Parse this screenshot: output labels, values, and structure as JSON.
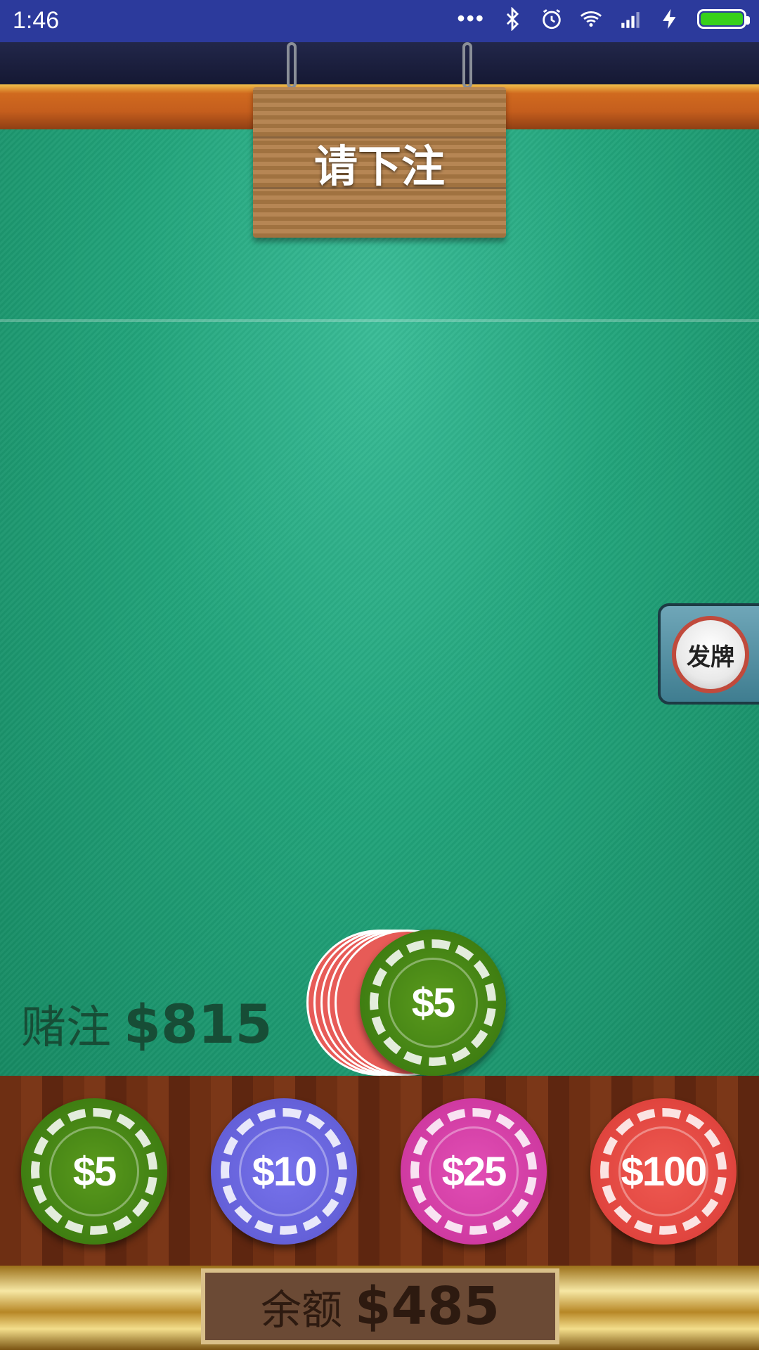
{
  "status_bar": {
    "time": "1:46",
    "icons": [
      "more-dots-icon",
      "bluetooth-icon",
      "alarm-icon",
      "wifi-icon",
      "signal-icon",
      "charging-icon",
      "battery-icon"
    ],
    "battery_level": 1.0
  },
  "sign": {
    "text": "请下注"
  },
  "deal_button": {
    "label": "发牌"
  },
  "bet": {
    "label": "赌注",
    "amount": "$815"
  },
  "stack": {
    "top_chip_label": "$5"
  },
  "chips": [
    {
      "label": "$5",
      "color": "#3f7e12"
    },
    {
      "label": "$10",
      "color": "#6460d8"
    },
    {
      "label": "$25",
      "color": "#cf3aa1"
    },
    {
      "label": "$100",
      "color": "#e0443e"
    }
  ],
  "balance": {
    "label": "余额",
    "amount": "$485"
  }
}
